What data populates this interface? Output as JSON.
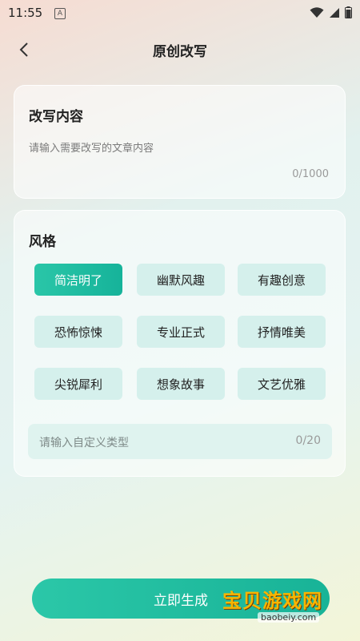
{
  "status": {
    "time": "11:55",
    "indicator": "A"
  },
  "header": {
    "title": "原创改写",
    "back_icon": "chevron-left-icon"
  },
  "rewrite": {
    "label": "改写内容",
    "placeholder": "请输入需要改写的文章内容",
    "counter": "0/1000"
  },
  "style": {
    "label": "风格",
    "options": [
      "简洁明了",
      "幽默风趣",
      "有趣创意",
      "恐怖惊悚",
      "专业正式",
      "抒情唯美",
      "尖锐犀利",
      "想象故事",
      "文艺优雅"
    ],
    "selected": "简洁明了",
    "custom_placeholder": "请输入自定义类型",
    "custom_counter": "0/20"
  },
  "actions": {
    "generate_label": "立即生成"
  },
  "watermark": {
    "text": "宝贝游戏网",
    "url": "baobeiy.com"
  },
  "colors": {
    "accent": "#1fbc9f",
    "chip_bg": "#d5f0ec"
  }
}
